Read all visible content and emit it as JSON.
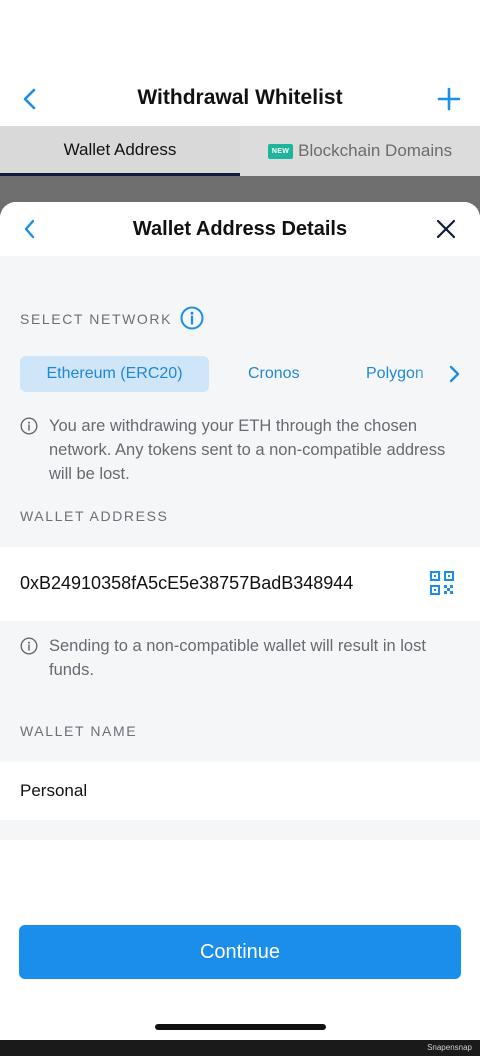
{
  "header": {
    "title": "Withdrawal Whitelist"
  },
  "tabs": [
    {
      "label": "Wallet Address",
      "active": true
    },
    {
      "label": "Blockchain Domains",
      "badge": "NEW",
      "active": false
    }
  ],
  "sheet": {
    "title": "Wallet Address Details",
    "select_network_label": "SELECT NETWORK",
    "networks": [
      {
        "label": "Ethereum (ERC20)",
        "selected": true
      },
      {
        "label": "Cronos",
        "selected": false
      },
      {
        "label": "Polygon",
        "selected": false
      }
    ],
    "network_note": "You are withdrawing your ETH through the chosen network. Any tokens sent to a non-compatible address will be lost.",
    "wallet_address_label": "WALLET ADDRESS",
    "wallet_address_value": "0xB24910358fA5cE5e38757BadB348944",
    "wallet_note": "Sending to a non-compatible wallet will result in lost funds.",
    "wallet_name_label": "WALLET NAME",
    "wallet_name_value": "Personal",
    "continue_label": "Continue"
  },
  "watermark": "Snapensnap",
  "colors": {
    "accent": "#1a8eea",
    "chip_bg": "#cfe6f8",
    "badge": "#1fb59c",
    "nav_dark": "#0d1c3d"
  },
  "icons": [
    "chevron-left-icon",
    "plus-icon",
    "close-icon",
    "info-icon",
    "chevron-right-icon",
    "qr-code-icon"
  ]
}
